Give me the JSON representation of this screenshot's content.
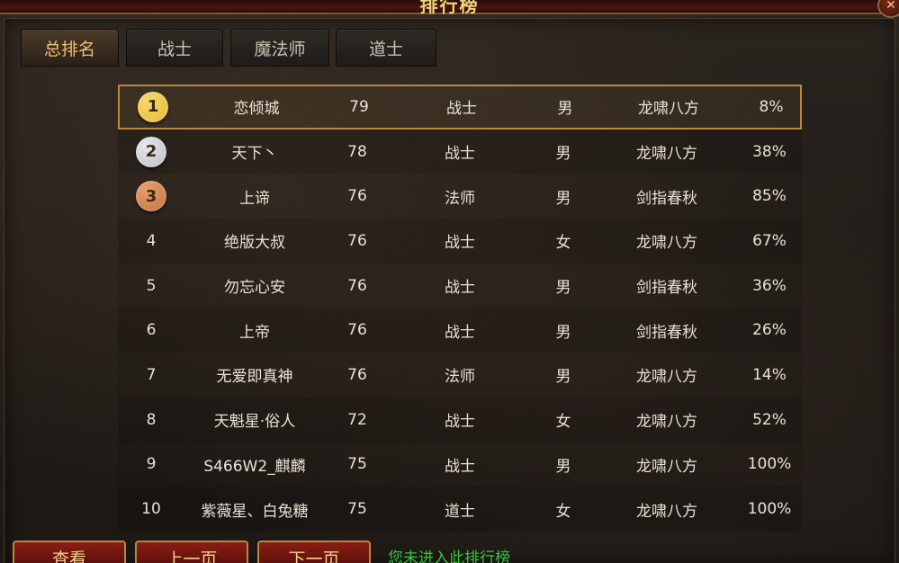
{
  "window": {
    "title": "排行榜"
  },
  "tabs": [
    {
      "label": "总排名",
      "active": true
    },
    {
      "label": "战士",
      "active": false
    },
    {
      "label": "魔法师",
      "active": false
    },
    {
      "label": "道士",
      "active": false
    }
  ],
  "rows": [
    {
      "rank": "1",
      "name": "恋倾城",
      "level": "79",
      "class": "战士",
      "gender": "男",
      "guild": "龙啸八方",
      "pct": "8%",
      "medal": "gold"
    },
    {
      "rank": "2",
      "name": "天下丶",
      "level": "78",
      "class": "战士",
      "gender": "男",
      "guild": "龙啸八方",
      "pct": "38%",
      "medal": "silver"
    },
    {
      "rank": "3",
      "name": "上谛",
      "level": "76",
      "class": "法师",
      "gender": "男",
      "guild": "剑指春秋",
      "pct": "85%",
      "medal": "bronze"
    },
    {
      "rank": "4",
      "name": "绝版大叔",
      "level": "76",
      "class": "战士",
      "gender": "女",
      "guild": "龙啸八方",
      "pct": "67%"
    },
    {
      "rank": "5",
      "name": "勿忘心安",
      "level": "76",
      "class": "战士",
      "gender": "男",
      "guild": "剑指春秋",
      "pct": "36%"
    },
    {
      "rank": "6",
      "name": "上帝",
      "level": "76",
      "class": "战士",
      "gender": "男",
      "guild": "剑指春秋",
      "pct": "26%"
    },
    {
      "rank": "7",
      "name": "无爱即真神",
      "level": "76",
      "class": "法师",
      "gender": "男",
      "guild": "龙啸八方",
      "pct": "14%"
    },
    {
      "rank": "8",
      "name": "天魁星·俗人",
      "level": "72",
      "class": "战士",
      "gender": "女",
      "guild": "龙啸八方",
      "pct": "52%"
    },
    {
      "rank": "9",
      "name": "S466W2_麒麟",
      "level": "75",
      "class": "战士",
      "gender": "男",
      "guild": "龙啸八方",
      "pct": "100%"
    },
    {
      "rank": "10",
      "name": "紫薇星、白兔糖",
      "level": "75",
      "class": "道士",
      "gender": "女",
      "guild": "龙啸八方",
      "pct": "100%"
    }
  ],
  "buttons": {
    "view": "查看",
    "prev": "上一页",
    "next": "下一页"
  },
  "status": "您未进入此排行榜",
  "colors": {
    "accent_gold": "#f0c070",
    "status_green": "#2ec83a",
    "button_red": "#8a1e14",
    "medal_gold": "#e8b838",
    "medal_silver": "#b8bcc4",
    "medal_bronze": "#c0703a"
  }
}
